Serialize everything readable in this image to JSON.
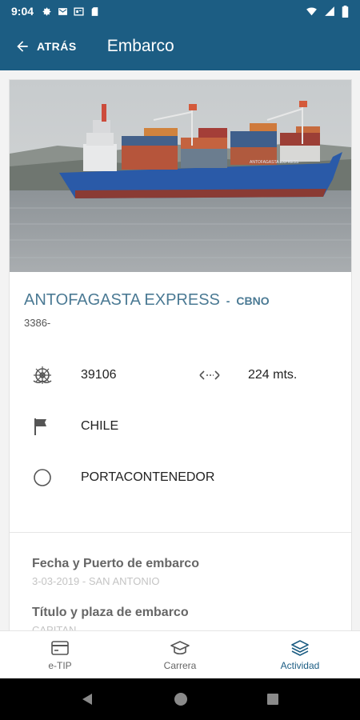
{
  "status_bar": {
    "time": "9:04",
    "left_icons": [
      "settings-icon",
      "mail-icon",
      "cast-icon",
      "sd-card-icon"
    ],
    "right_icons": [
      "wifi-icon",
      "signal-icon",
      "battery-icon"
    ]
  },
  "app_bar": {
    "back_label": "ATRÁS",
    "title": "Embarco"
  },
  "ship": {
    "name": "ANTOFAGASTA EXPRESS",
    "code_separator": " - ",
    "code": "CBNO",
    "id": "3386-",
    "tonnage": "39106",
    "length": "224 mts.",
    "flag": "CHILE",
    "type": "PORTACONTENEDOR"
  },
  "details": {
    "embark_label": "Fecha y Puerto de embarco",
    "embark_value": "3-03-2019 - SAN ANTONIO",
    "title_label": "Título y plaza de embarco",
    "title_value": "CAPITAN"
  },
  "bottom_nav": {
    "items": [
      {
        "label": "e-TIP",
        "icon": "card-icon"
      },
      {
        "label": "Carrera",
        "icon": "graduation-cap-icon"
      },
      {
        "label": "Actividad",
        "icon": "layers-icon"
      }
    ],
    "active": "Actividad"
  },
  "colors": {
    "primary": "#1c5d83",
    "name_text": "#4b7a94",
    "muted_value": "#c4c4c4"
  }
}
